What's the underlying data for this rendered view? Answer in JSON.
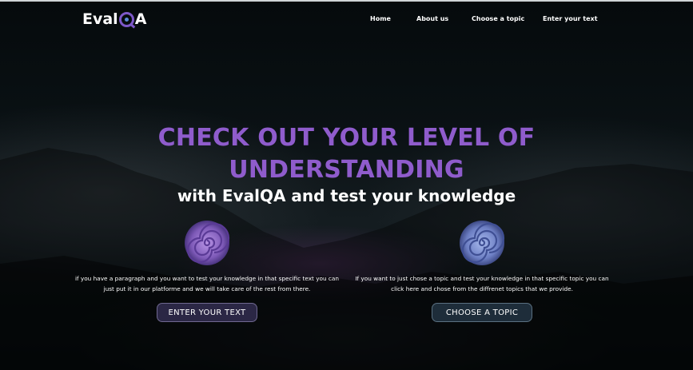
{
  "brand": {
    "name_prefix": "Eval",
    "name_suffix": "A"
  },
  "nav": {
    "items": [
      {
        "label": "Home"
      },
      {
        "label": "About us"
      },
      {
        "label": "Choose a topic"
      },
      {
        "label": "Enter your text"
      }
    ]
  },
  "hero": {
    "title_line1": "CHECK OUT YOUR LEVEL OF",
    "title_line2": "UNDERSTANDING",
    "subtitle": "with EvalQA and test your knowledge"
  },
  "cards": {
    "text": {
      "desc_line1": "if you have a paragraph and you want to test your knowledge in that specific text you can",
      "desc_line2": "just put it in our platforme and we will take care of the rest from there.",
      "button": "ENTER YOUR TEXT"
    },
    "topic": {
      "desc_line1": "If you want to just chose a topic and test your knowledge in that specific topic you can",
      "desc_line2": "click here and chose from the diffrenet topics that we provide.",
      "button": "CHOOSE A TOPIC"
    }
  },
  "colors": {
    "accent": "#8f5ccc",
    "text_button_bg": "#2b2745",
    "topic_button_bg": "#1e2d3a",
    "background": "#0b1114"
  },
  "icons": {
    "text_card": "purple-spiral-icon",
    "topic_card": "blue-spiral-icon"
  }
}
